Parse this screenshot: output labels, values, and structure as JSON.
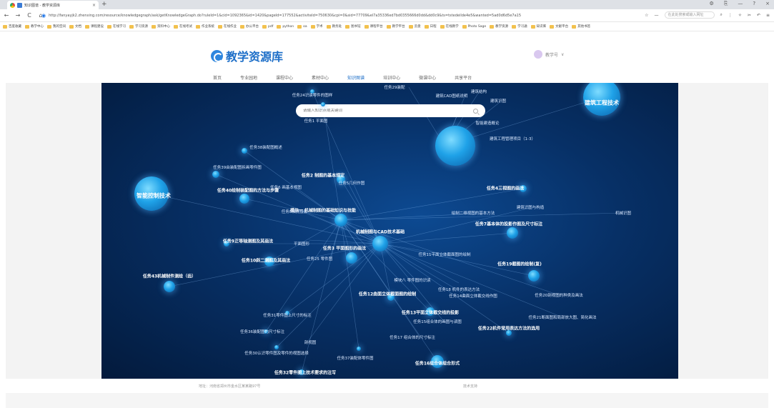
{
  "browser": {
    "tab_title": "知识图谱 - 教学资源库",
    "close_glyph": "×",
    "new_tab_glyph": "+",
    "url": "http://fanyayjk2.zhenxing.com/resource/knowledgegraph/ask/getKnowledgeGraph.do?ruleId=1&cid=1092365&id=1420&pageId=177552&activiteId=750630&cpi=0&sid=77709&el7a35336ed7bd0355666d0dd&dd0c9&ts=tstedeilde4e5&wanted=5ad0d6d5e7a15",
    "search_placeholder": "在此处搜索或输入网址",
    "window_controls": [
      "⚙",
      "⎘",
      "—",
      "?",
      "×"
    ],
    "bookmarks": [
      "百度收藏",
      "教学中心",
      "我的空间",
      "文档",
      "课程建设",
      "在线学习",
      "学习资源",
      "资料中心",
      "在线考试",
      "作业系统",
      "在线作业",
      "办公平台",
      "pdf",
      "python",
      "oa",
      "学术",
      "教务处",
      "图书馆",
      "课程平台",
      "教学平台",
      "云盘",
      "日程",
      "在线教学",
      "Photo Sage",
      "教学资源",
      "学习通",
      "知识库",
      "文献平台",
      "其他书签"
    ]
  },
  "site": {
    "logo_text": "教学资源库",
    "user_name": "教学号",
    "user_caret": "∨",
    "nav": [
      "首页",
      "专业园地",
      "课程中心",
      "素材中心",
      "知识图谱",
      "培训中心",
      "微课中心",
      "共享平台"
    ]
  },
  "graph": {
    "search_placeholder": "请输入知识点或关键词",
    "nodes": [
      {
        "label": "建筑工程技术",
        "kind": "big"
      },
      {
        "label": "智能控制技术",
        "kind": "big"
      },
      {
        "label": "机械制图与CAD技术基础",
        "kind": "bold"
      },
      {
        "label": "模块一 机械制图的基础知识与技能",
        "kind": "bold"
      },
      {
        "label": "任务43机械制件测绘（齿）",
        "kind": "bold"
      },
      {
        "label": "任务40绘制装配图的方法与步骤",
        "kind": "bold"
      },
      {
        "label": "任务39由装配图拆画零件图",
        "kind": "normal"
      },
      {
        "label": "任务38装配图概述",
        "kind": "normal"
      },
      {
        "label": "任务2 制图的基本规定",
        "kind": "bold"
      },
      {
        "label": "任务3 平面图形的画法",
        "kind": "bold"
      },
      {
        "label": "任务9正等轴测图及其画法",
        "kind": "bold"
      },
      {
        "label": "任务10斜二测图及其画法",
        "kind": "bold"
      },
      {
        "label": "任务7基本体的投影作图及尺寸标注",
        "kind": "bold"
      },
      {
        "label": "任务4三视图的画法",
        "kind": "bold"
      },
      {
        "label": "任务19截图的绘制(复)",
        "kind": "bold"
      },
      {
        "label": "任务13平面立体截交线的投影",
        "kind": "bold"
      },
      {
        "label": "任务12曲面立体截面图的绘制",
        "kind": "bold"
      },
      {
        "label": "任务16组合体组合形式",
        "kind": "bold"
      },
      {
        "label": "任务22机件常用表达方法的选用",
        "kind": "bold"
      },
      {
        "label": "任务32零件图上技术要求的注写",
        "kind": "bold"
      },
      {
        "label": "任务31零件图上尺寸的标注",
        "kind": "normal"
      },
      {
        "label": "任务36装配图的尺寸标注",
        "kind": "normal"
      },
      {
        "label": "任务30认识零件图及零件的视图选择",
        "kind": "normal"
      },
      {
        "label": "任务37装配体零件图",
        "kind": "normal"
      },
      {
        "label": "任务24识读零件的图样",
        "kind": "normal"
      },
      {
        "label": "任务1 平面图",
        "kind": "normal"
      },
      {
        "label": "智能建造概论",
        "kind": "normal"
      },
      {
        "label": "建筑工程管理项目（1-3）",
        "kind": "normal"
      },
      {
        "label": "任务29装配",
        "kind": "normal"
      },
      {
        "label": "建筑CAD图纸说明",
        "kind": "normal"
      },
      {
        "label": "建筑识图",
        "kind": "normal"
      },
      {
        "label": "建筑结构",
        "kind": "normal"
      },
      {
        "label": "任务5几何作图",
        "kind": "normal"
      },
      {
        "label": "任务6 画基本视图",
        "kind": "normal"
      },
      {
        "label": "任务8轴测投影",
        "kind": "normal"
      },
      {
        "label": "绘制二维视图的基本方法",
        "kind": "normal"
      },
      {
        "label": "任务11平面立体截面图的绘制",
        "kind": "normal"
      },
      {
        "label": "任务14曲面立体截交线作图",
        "kind": "normal"
      },
      {
        "label": "任务15组合体的画图与读图",
        "kind": "normal"
      },
      {
        "label": "任务20剖视图的种类及画法",
        "kind": "normal"
      },
      {
        "label": "任务21断面图和局部放大图、简化画法",
        "kind": "normal"
      },
      {
        "label": "任务17 组合体的尺寸标注",
        "kind": "normal"
      },
      {
        "label": "建筑识图与构造",
        "kind": "normal"
      },
      {
        "label": "机械识图",
        "kind": "normal"
      },
      {
        "label": "平面图形",
        "kind": "normal"
      },
      {
        "label": "任务25 零件图",
        "kind": "normal"
      },
      {
        "label": "模块八 零件图的识读",
        "kind": "normal"
      },
      {
        "label": "任务18 机件的表达方法",
        "kind": "normal"
      },
      {
        "label": "剖视图",
        "kind": "normal"
      }
    ]
  },
  "footer": {
    "left": "地址：河南省郑州市金水区某某路97号",
    "right": "技术支持"
  }
}
